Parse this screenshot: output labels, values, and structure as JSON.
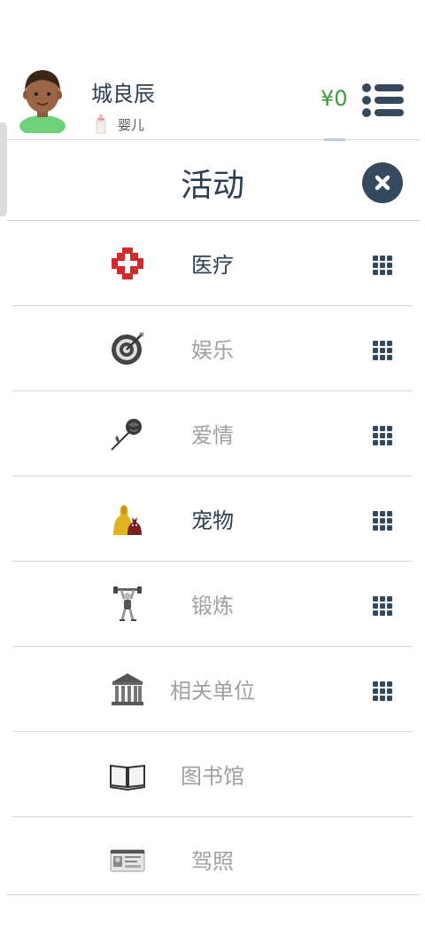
{
  "profile": {
    "name": "城良辰",
    "stage": "婴儿",
    "money": "¥0"
  },
  "panel": {
    "title": "活动"
  },
  "activities": [
    {
      "label": "医疗",
      "icon": "hospital-cross-icon",
      "enabled": true,
      "has_grid": true
    },
    {
      "label": "娱乐",
      "icon": "target-icon",
      "enabled": false,
      "has_grid": true
    },
    {
      "label": "爱情",
      "icon": "rose-icon",
      "enabled": false,
      "has_grid": true
    },
    {
      "label": "宠物",
      "icon": "pets-icon",
      "enabled": true,
      "has_grid": true
    },
    {
      "label": "锻炼",
      "icon": "weightlifter-icon",
      "enabled": false,
      "has_grid": true
    },
    {
      "label": "相关单位",
      "icon": "bank-building-icon",
      "enabled": false,
      "has_grid": true
    },
    {
      "label": "图书馆",
      "icon": "open-book-icon",
      "enabled": false,
      "has_grid": false
    },
    {
      "label": "驾照",
      "icon": "driver-license-icon",
      "enabled": false,
      "has_grid": false
    }
  ],
  "colors": {
    "title": "#2c3e50",
    "inactive": "#a0a0a0",
    "money": "#3a9b3a",
    "close_bg": "#34495e"
  }
}
